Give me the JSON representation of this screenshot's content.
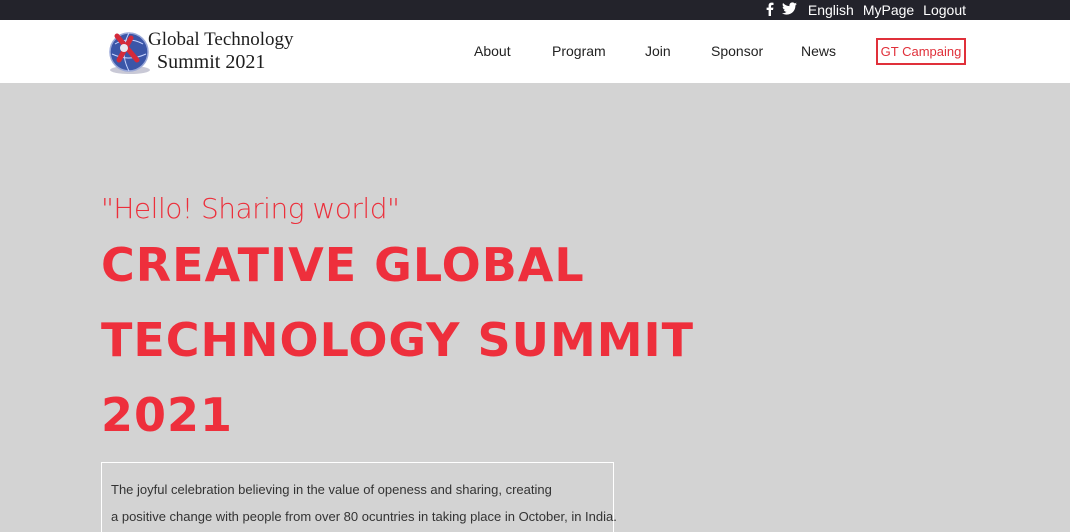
{
  "topbar": {
    "social_icons": [
      "facebook-icon",
      "twitter-icon"
    ],
    "links": {
      "language": "English",
      "mypage": "MyPage",
      "logout": "Logout"
    }
  },
  "logo": {
    "line1": "Global Technology",
    "line2": "Summit 2021"
  },
  "nav": {
    "about": "About",
    "program": "Program",
    "join": "Join",
    "sponsor": "Sponsor",
    "news": "News",
    "campaign": "GT Campaing"
  },
  "hero": {
    "subtitle": "\"Hello! Sharing world\"",
    "title_line1": "CREATIVE GLOBAL",
    "title_line2": "TECHNOLOGY SUMMIT",
    "title_line3": "2021"
  },
  "description": {
    "line1": "The joyful celebration believing in the value of openess and sharing, creating",
    "line2": "a positive change with people from over 80 ocuntries in taking place in October, in India."
  },
  "colors": {
    "accent": "#ee2f3c",
    "topbar": "#23232b",
    "hero_bg": "#d3d3d3"
  }
}
